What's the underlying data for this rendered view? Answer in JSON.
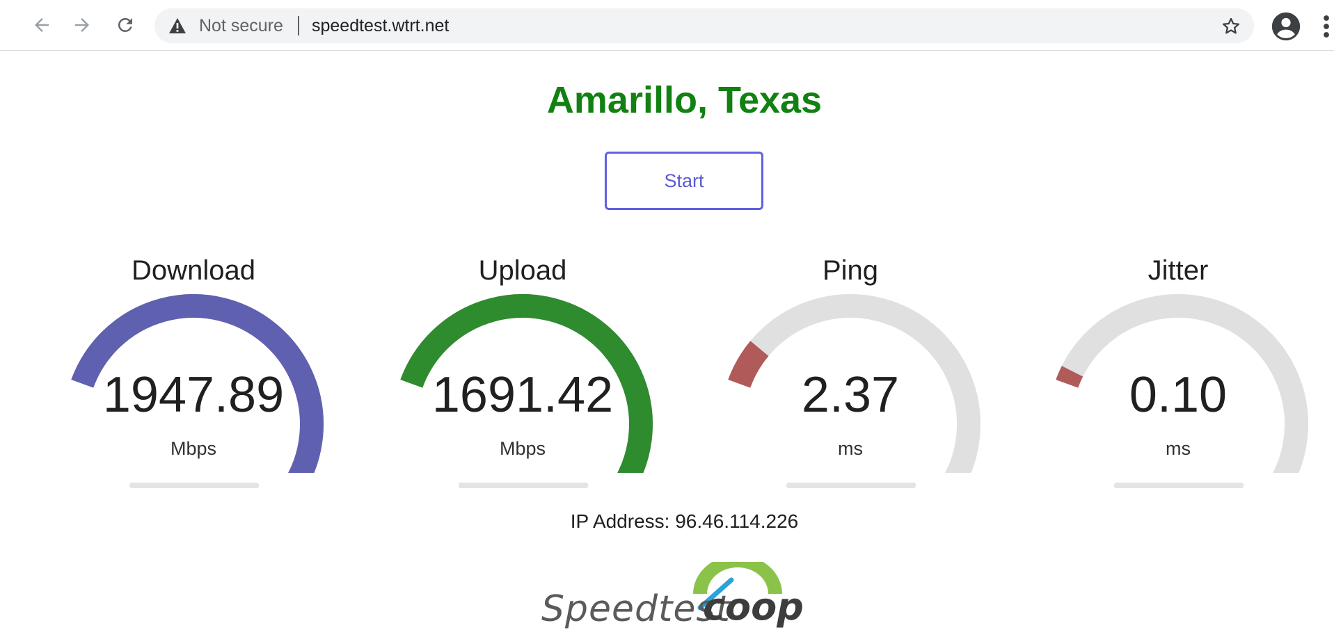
{
  "browser": {
    "security_label": "Not secure",
    "url": "speedtest.wtrt.net"
  },
  "page": {
    "title": "Amarillo, Texas",
    "start_label": "Start",
    "ip_address": "IP Address: 96.46.114.226"
  },
  "gauges": [
    {
      "label": "Download",
      "value": "1947.89",
      "unit": "Mbps",
      "fill_fraction": 1.0,
      "color": "#6060b0"
    },
    {
      "label": "Upload",
      "value": "1691.42",
      "unit": "Mbps",
      "fill_fraction": 1.0,
      "color": "#2e8b2e"
    },
    {
      "label": "Ping",
      "value": "2.37",
      "unit": "ms",
      "fill_fraction": 0.09,
      "color": "#b05a5a"
    },
    {
      "label": "Jitter",
      "value": "0.10",
      "unit": "ms",
      "fill_fraction": 0.03,
      "color": "#b05a5a"
    }
  ],
  "gauge_track_color": "#e0e0e0",
  "logo": {
    "text_speedtest": "Speedtest",
    "text_coop": "coop"
  },
  "icons": [
    "back-arrow-icon",
    "forward-arrow-icon",
    "reload-icon",
    "warning-icon",
    "star-icon",
    "profile-icon",
    "kebab-menu-icon"
  ]
}
